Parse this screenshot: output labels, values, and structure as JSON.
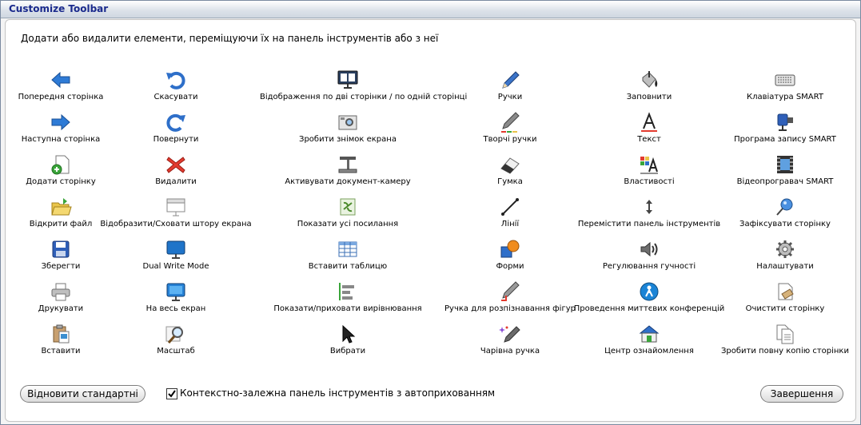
{
  "window": {
    "title": "Customize Toolbar"
  },
  "instruction": "Додати або видалити елементи, переміщуючи їх на панель інструментів або з неї",
  "columns": [
    [
      {
        "label": "Попередня сторінка",
        "icon": "arrow-left-icon"
      },
      {
        "label": "Наступна сторінка",
        "icon": "arrow-right-icon"
      },
      {
        "label": "Додати сторінку",
        "icon": "add-page-icon"
      },
      {
        "label": "Відкрити файл",
        "icon": "open-folder-icon"
      },
      {
        "label": "Зберегти",
        "icon": "save-icon"
      },
      {
        "label": "Друкувати",
        "icon": "print-icon"
      },
      {
        "label": "Вставити",
        "icon": "paste-icon"
      }
    ],
    [
      {
        "label": "Скасувати",
        "icon": "undo-icon"
      },
      {
        "label": "Повернути",
        "icon": "redo-icon"
      },
      {
        "label": "Видалити",
        "icon": "delete-icon"
      },
      {
        "label": "Відобразити/Сховати штору екрана",
        "icon": "screen-shade-icon"
      },
      {
        "label": "Dual Write Mode",
        "icon": "dual-write-icon"
      },
      {
        "label": "На весь екран",
        "icon": "full-screen-icon"
      },
      {
        "label": "Масштаб",
        "icon": "zoom-icon"
      }
    ],
    [
      {
        "label": "Відображення по дві сторінки / по одній сторінці",
        "icon": "dual-page-icon"
      },
      {
        "label": "Зробити знімок екрана",
        "icon": "screen-capture-icon"
      },
      {
        "label": "Активувати документ-камеру",
        "icon": "document-camera-icon"
      },
      {
        "label": "Показати усі посилання",
        "icon": "show-links-icon"
      },
      {
        "label": "Вставити таблицю",
        "icon": "insert-table-icon"
      },
      {
        "label": "Показати/приховати вирівнювання",
        "icon": "alignment-icon"
      },
      {
        "label": "Вибрати",
        "icon": "select-arrow-icon"
      }
    ],
    [
      {
        "label": "Ручки",
        "icon": "pen-icon"
      },
      {
        "label": "Творчі ручки",
        "icon": "creative-pen-icon"
      },
      {
        "label": "Гумка",
        "icon": "eraser-icon"
      },
      {
        "label": "Лінії",
        "icon": "line-icon"
      },
      {
        "label": "Форми",
        "icon": "shapes-icon"
      },
      {
        "label": "Ручка для розпізнавання фігур",
        "icon": "shape-pen-icon"
      },
      {
        "label": "Чарівна ручка",
        "icon": "magic-pen-icon"
      }
    ],
    [
      {
        "label": "Заповнити",
        "icon": "fill-bucket-icon"
      },
      {
        "label": "Текст",
        "icon": "text-icon"
      },
      {
        "label": "Властивості",
        "icon": "properties-icon"
      },
      {
        "label": "Перемістити панель інструментів",
        "icon": "move-toolbar-icon"
      },
      {
        "label": "Регулювання гучності",
        "icon": "volume-icon"
      },
      {
        "label": "Проведення миттєвих конференцій",
        "icon": "conference-icon"
      },
      {
        "label": "Центр ознайомлення",
        "icon": "welcome-center-icon"
      }
    ],
    [
      {
        "label": "Клавіатура SMART",
        "icon": "keyboard-icon"
      },
      {
        "label": "Програма запису SMART",
        "icon": "recorder-icon"
      },
      {
        "label": "Відеопрогравач SMART",
        "icon": "video-player-icon"
      },
      {
        "label": "Зафіксувати сторінку",
        "icon": "pin-page-icon"
      },
      {
        "label": "Налаштувати",
        "icon": "gear-icon"
      },
      {
        "label": "Очистити сторінку",
        "icon": "clear-page-icon"
      },
      {
        "label": "Зробити повну копію сторінки",
        "icon": "clone-page-icon"
      }
    ]
  ],
  "restore_button": "Відновити стандартні",
  "autohide_checkbox": {
    "label": "Контекстно-залежна панель інструментів з автоприхованням",
    "checked": true
  },
  "done_button": "Завершення"
}
